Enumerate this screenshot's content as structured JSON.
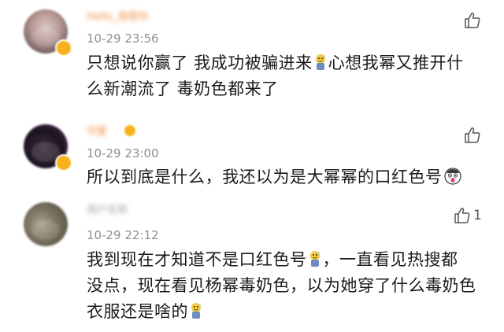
{
  "comments": [
    {
      "username": "Hello_我是你",
      "timestamp": "10-29 23:56",
      "text_line_1a": "只想说你赢了 我成功被骗进来",
      "text_line_1b": "心想我幂又推开什",
      "text_line_2": "么新潮流了 毒奶色都来了",
      "emoji": "sweat-smile-emoji",
      "like_icon": "thumbs-up-icon"
    },
    {
      "username": "可爱",
      "timestamp": "10-29 23:00",
      "text_line_1": "所以到底是什么，我还以为是大幂幂的口红色号",
      "emoji": "shocked-face-emoji",
      "like_icon": "thumbs-up-icon"
    },
    {
      "username": "用户名称",
      "timestamp": "10-29 22:12",
      "text_line_1a": "我到现在才知道不是口红色号",
      "text_line_1b": "，一直看见热搜都",
      "text_line_2": "没点，现在看见杨幂毒奶色，以为她穿了什么毒奶色",
      "text_line_3": "衣服还是啥的",
      "emoji": "sweat-smile-emoji",
      "like_icon": "thumbs-up-icon",
      "like_count": "1"
    }
  ],
  "colors": {
    "username": "#f08a3c",
    "timestamp": "#8f8f8f",
    "body": "#1a1a1a",
    "badge": "#f7b21a"
  }
}
